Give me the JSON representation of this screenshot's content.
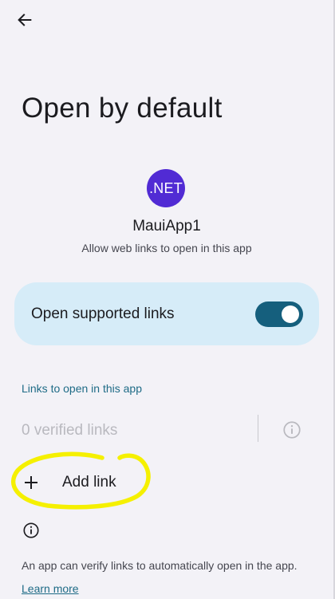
{
  "header": {
    "back_icon": "arrow-back-icon",
    "title": "Open by default"
  },
  "app": {
    "icon_label": ".NET",
    "icon_color": "#512bd4",
    "name": "MauiApp1",
    "description": "Allow web links to open in this app"
  },
  "open_supported_links": {
    "label": "Open supported links",
    "enabled": true,
    "card_color": "#d6ecf8",
    "switch_color": "#155f7d"
  },
  "links_section": {
    "header": "Links to open in this app",
    "verified_links": "0 verified links",
    "info_icon": "info-icon",
    "add_icon": "plus-icon",
    "add_link_label": "Add link"
  },
  "annotation": {
    "type": "hand-drawn ellipse",
    "color": "#f5f000"
  },
  "footer": {
    "info_icon": "info-icon",
    "text": "An app can verify links to automatically open in the app.",
    "learn_more": "Learn more"
  }
}
